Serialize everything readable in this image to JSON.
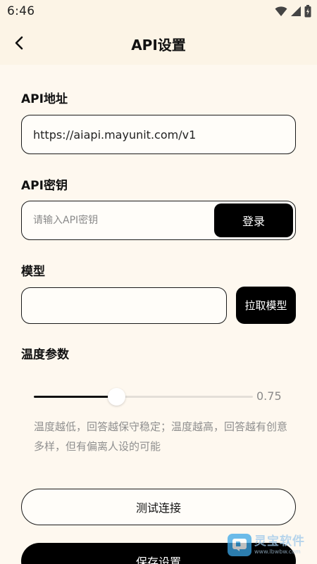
{
  "status_bar": {
    "time": "6:46"
  },
  "header": {
    "title": "API设置"
  },
  "api_url": {
    "label": "API地址",
    "value": "https://aiapi.mayunit.com/v1"
  },
  "api_key": {
    "label": "API密钥",
    "placeholder": "请输入API密钥",
    "value": "",
    "login_label": "登录"
  },
  "model": {
    "label": "模型",
    "value": "",
    "fetch_label": "拉取模型"
  },
  "temperature": {
    "label": "温度参数",
    "value": 0.75,
    "value_text": "0.75",
    "slider_fraction": 0.375,
    "hint": "温度越低，回答越保守稳定；温度越高，回答越有创意多样，但有偏离人设的可能"
  },
  "actions": {
    "test_label": "测试连接",
    "save_label": "保存设置"
  },
  "watermark": {
    "name": "灵宝软件",
    "url": "www.lbwbw.com"
  },
  "colors": {
    "background": "#FEF8EF",
    "header": "#FCF4E6",
    "primary": "#000000",
    "muted_text": "#8F8F8F"
  },
  "icons": {
    "back": "chevron-left-icon",
    "wifi": "wifi-icon",
    "signal": "signal-icon",
    "battery": "battery-icon"
  }
}
